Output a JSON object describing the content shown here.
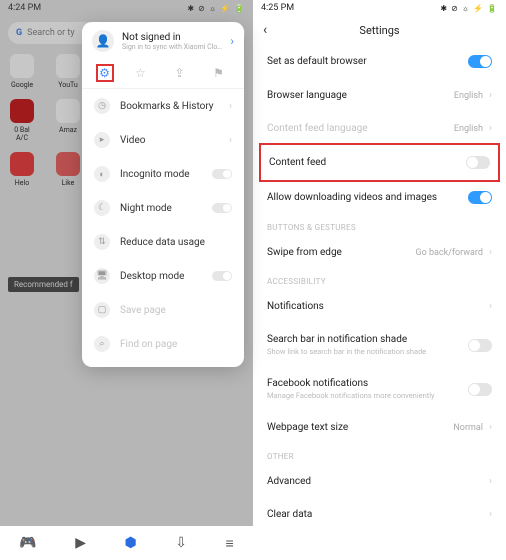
{
  "left": {
    "status_time": "4:24 PM",
    "status_icons": "✱ ⊘ ☼ ⚡ 🔋",
    "search_placeholder": "Search or ty",
    "apps_row1": [
      "Google",
      "YouTu",
      "",
      "",
      ""
    ],
    "apps_row2_labels": [
      "0 Bal A/C",
      "Amaz",
      "",
      "",
      ""
    ],
    "apps_row3_labels": [
      "Helo",
      "Like",
      "",
      "",
      ""
    ],
    "recommended": "Recommended f",
    "popup": {
      "signin_title": "Not signed in",
      "signin_sub": "Sign in to sync with Xiaomi Clo…",
      "rows": {
        "bookmarks": "Bookmarks & History",
        "video": "Video",
        "incognito": "Incognito mode",
        "night": "Night mode",
        "reduce": "Reduce data usage",
        "desktop": "Desktop mode",
        "save": "Save page",
        "find": "Find on page"
      }
    }
  },
  "right": {
    "status_time": "4:25 PM",
    "status_icons": "✱ ⊘ ☼ ⚡ 🔋",
    "title": "Settings",
    "rows": {
      "default_browser": "Set as default browser",
      "browser_lang": "Browser language",
      "browser_lang_val": "English",
      "feed_lang": "Content feed language",
      "feed_lang_val": "English",
      "content_feed": "Content feed",
      "allow_dl": "Allow downloading videos and images",
      "swipe": "Swipe from edge",
      "swipe_val": "Go back/forward",
      "notifications": "Notifications",
      "search_notif": "Search bar in notification shade",
      "search_notif_sub": "Show link to search bar in the notification shade",
      "fb_notif": "Facebook notifications",
      "fb_notif_sub": "Manage Facebook notifications more conveniently",
      "text_size": "Webpage text size",
      "text_size_val": "Normal",
      "advanced": "Advanced",
      "clear": "Clear data"
    },
    "sections": {
      "buttons": "BUTTONS & GESTURES",
      "access": "ACCESSIBILITY",
      "other": "OTHER"
    }
  }
}
